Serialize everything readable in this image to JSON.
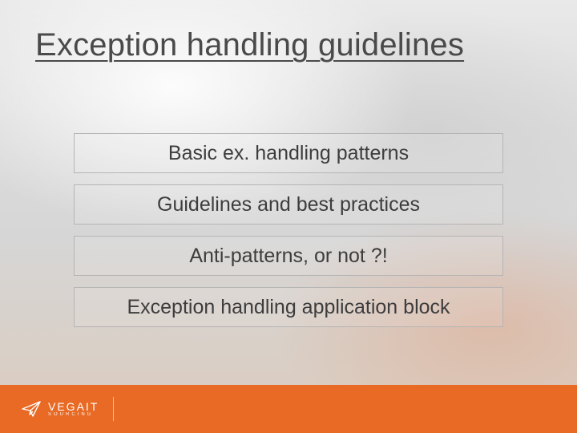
{
  "title": "Exception handling guidelines",
  "items": [
    "Basic ex. handling patterns",
    "Guidelines and best practices",
    "Anti-patterns, or not ?!",
    "Exception handling application block"
  ],
  "footer": {
    "brand": "VEGAIT",
    "brand_sub": "SOURCING"
  },
  "colors": {
    "accent": "#e86a24",
    "text": "#4a4a4a"
  }
}
